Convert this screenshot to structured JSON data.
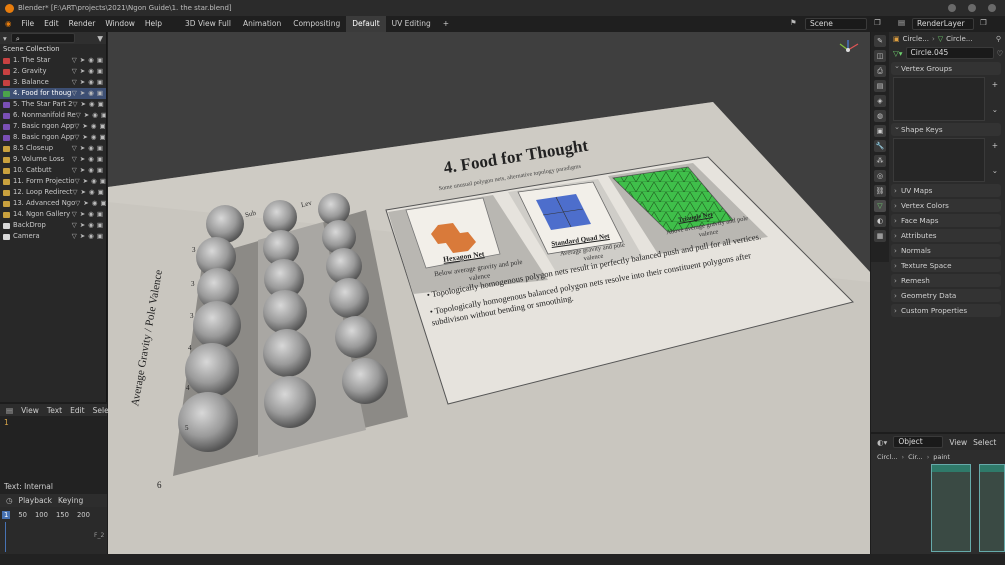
{
  "titlebar": {
    "title": "Blender* [F:\\ART\\projects\\2021\\Ngon Guide\\1. the star.blend]"
  },
  "menu": {
    "items": [
      "File",
      "Edit",
      "Render",
      "Window",
      "Help"
    ]
  },
  "workspaces": [
    {
      "label": "3D View Full",
      "active": false
    },
    {
      "label": "Animation",
      "active": false
    },
    {
      "label": "Compositing",
      "active": false
    },
    {
      "label": "Default",
      "active": true
    },
    {
      "label": "UV Editing",
      "active": false
    }
  ],
  "workspace_add": "+",
  "scene": {
    "name": "Scene",
    "view_layer": "RenderLayer"
  },
  "outliner": {
    "header": "Scene Collection",
    "items": [
      {
        "label": "1. The Star",
        "color": "#c84141",
        "selected": false
      },
      {
        "label": "2. Gravity",
        "color": "#c84141",
        "selected": false
      },
      {
        "label": "3. Balance",
        "color": "#c84141",
        "selected": false
      },
      {
        "label": "4. Food for thoug",
        "color": "#4ba34b",
        "selected": true
      },
      {
        "label": "5. The Star Part 2",
        "color": "#7a4fb5",
        "selected": false
      },
      {
        "label": "6. Nonmanifold Re",
        "color": "#7a4fb5",
        "selected": false
      },
      {
        "label": "7. Basic ngon App",
        "color": "#7a4fb5",
        "selected": false
      },
      {
        "label": "8. Basic ngon App",
        "color": "#7a4fb5",
        "selected": false
      },
      {
        "label": "8.5 Closeup",
        "color": "#c9a13e",
        "selected": false
      },
      {
        "label": "9. Volume Loss",
        "color": "#c9a13e",
        "selected": false
      },
      {
        "label": "10. Catbutt",
        "color": "#c9a13e",
        "selected": false
      },
      {
        "label": "11. Form Projectio",
        "color": "#c9a13e",
        "selected": false
      },
      {
        "label": "12. Loop Redirect",
        "color": "#c9a13e",
        "selected": false
      },
      {
        "label": "13. Advanced Ngo",
        "color": "#c9a13e",
        "selected": false
      },
      {
        "label": "14. Ngon Gallery",
        "color": "#c9a13e",
        "selected": false
      },
      {
        "label": "BackDrop",
        "color": "#d9d9d9",
        "selected": false
      },
      {
        "label": "Camera",
        "color": "#d9d9d9",
        "selected": false
      }
    ]
  },
  "text_editor": {
    "menus": [
      "View",
      "Text",
      "Edit",
      "Sele"
    ],
    "line_number": "1",
    "status": "Text: Internal"
  },
  "timeline": {
    "menus": [
      "Playback",
      "Keying"
    ],
    "frame": "1",
    "ticks": [
      "50",
      "100",
      "150",
      "200"
    ],
    "end_label": "F_2"
  },
  "properties": {
    "breadcrumb": [
      "Circle...",
      "Circle..."
    ],
    "mesh_name": "Circle.045",
    "panels": [
      {
        "label": "Vertex Groups",
        "open": true
      },
      {
        "label": "Shape Keys",
        "open": true
      },
      {
        "label": "UV Maps",
        "open": false
      },
      {
        "label": "Vertex Colors",
        "open": false
      },
      {
        "label": "Face Maps",
        "open": false
      },
      {
        "label": "Attributes",
        "open": false
      },
      {
        "label": "Normals",
        "open": false
      },
      {
        "label": "Texture Space",
        "open": false
      },
      {
        "label": "Remesh",
        "open": false
      },
      {
        "label": "Geometry Data",
        "open": false
      },
      {
        "label": "Custom Properties",
        "open": false
      }
    ]
  },
  "node_editor": {
    "mode": "Object",
    "menus": [
      "View",
      "Select"
    ],
    "breadcrumb": [
      "Circl...",
      "Cir...",
      "paint"
    ]
  },
  "board": {
    "title": "4. Food for Thought",
    "subtitle": "Some unusual polygon nets, alternative topology paradigms",
    "cards": [
      {
        "title": "Hexagon Net",
        "caption": "Below average gravity and pole valence"
      },
      {
        "title": "Standard Quad Net",
        "caption": "Average gravity and pole valence"
      },
      {
        "title": "Triangle Net",
        "caption": "Above average gravity and pole valence"
      }
    ],
    "bullets": [
      "Topologically homogenous polygon nets result in perfectly balanced push and pull for all vertices.",
      "Topologically homogenous balanced polygon nets resolve into their constituent polygons after subdivison without bending or smoothing."
    ],
    "sphere_axis_label": "Average Gravity / Pole Valence",
    "sphere_col_labels": [
      "Sub",
      "Lev"
    ],
    "row_numbers": [
      "3",
      "3",
      "3",
      "4",
      "4",
      "5",
      "6"
    ]
  }
}
